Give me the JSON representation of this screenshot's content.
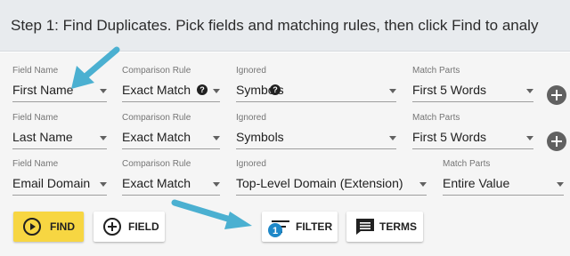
{
  "header": {
    "instructions": "Step 1: Find Duplicates. Pick fields and matching rules, then click Find to analy"
  },
  "labels": {
    "field_name": "Field Name",
    "comparison_rule": "Comparison Rule",
    "ignored": "Ignored",
    "match_parts": "Match Parts"
  },
  "rows": [
    {
      "field": "First Name",
      "comparison": "Exact Match",
      "ignored": "Symbols",
      "match_parts": "First 5 Words"
    },
    {
      "field": "Last Name",
      "comparison": "Exact Match",
      "ignored": "Symbols",
      "match_parts": "First 5 Words"
    },
    {
      "field": "Email Domain",
      "comparison": "Exact Match",
      "ignored": "Top-Level Domain (Extension)",
      "match_parts": "Entire Value"
    }
  ],
  "help_glyph": "?",
  "buttons": {
    "find": "FIND",
    "field": "FIELD",
    "filter": "FILTER",
    "filter_badge": "1",
    "terms": "TERMS"
  },
  "colors": {
    "find_button": "#f7d642",
    "annotation_arrow": "#4bb0d1",
    "badge": "#1e88c8"
  },
  "icons": {
    "find": "play-circle-icon",
    "field": "add-circle-icon",
    "filter": "filter-list-icon",
    "terms": "comment-icon",
    "add_row": "add-circle-icon"
  }
}
